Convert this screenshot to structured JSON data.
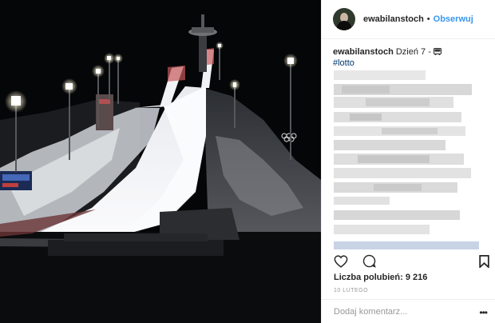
{
  "header": {
    "username": "ewabilanstoch",
    "separator": "•",
    "follow_label": "Obserwuj"
  },
  "caption": {
    "username": "ewabilanstoch",
    "text": "Dzień 7 -",
    "emoji_icon": "bus-icon",
    "hashtag": "#lotto"
  },
  "actions": {
    "like_icon": "heart-icon",
    "comment_icon": "comment-icon",
    "save_icon": "bookmark-icon"
  },
  "likes_text": "Liczba polubień: 9 216",
  "date_text": "10 LUTEGO",
  "comment": {
    "placeholder": "Dodaj komentarz...",
    "more_label": "•••"
  },
  "colors": {
    "link": "#3897f0",
    "hashtag": "#003569",
    "text": "#262626",
    "muted": "#999999"
  }
}
